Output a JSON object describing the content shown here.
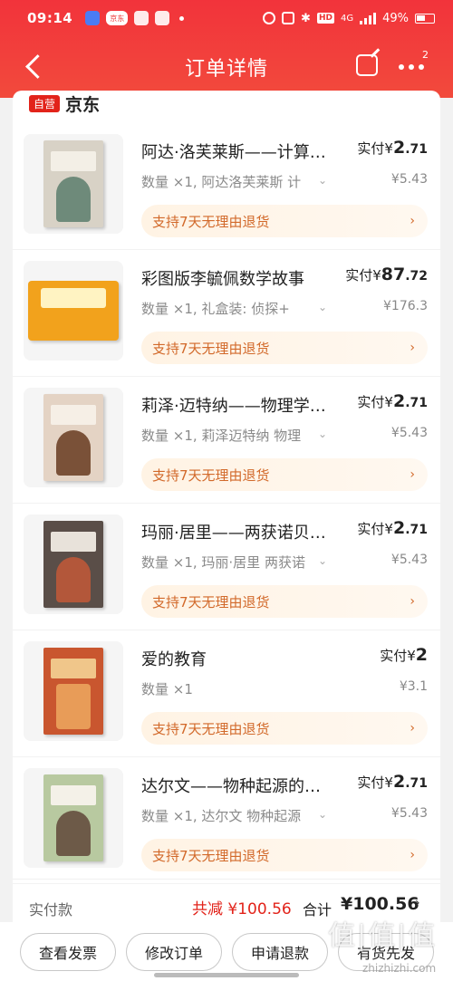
{
  "status": {
    "time": "09:14",
    "app_badge": "京东",
    "network": "4G",
    "hd": "HD",
    "battery": "49%"
  },
  "nav": {
    "title": "订单详情",
    "more_badge": "2"
  },
  "shop": {
    "badge": "自营",
    "name": "京东"
  },
  "items": [
    {
      "title": "阿达·洛芙莱斯——计算机之母",
      "spec": "数量 ×1, 阿达洛芙莱斯 计",
      "price_prefix": "实付¥",
      "price_int": "2",
      "price_dec": ".71",
      "orig_price": "¥5.43",
      "return_label": "支持7天无理由退货",
      "cover_color": "#d8d2c6",
      "cover_accent": "#6e8a7a"
    },
    {
      "title": "彩图版李毓佩数学故事",
      "spec": "数量 ×1, 礼盒装: 侦探+",
      "price_prefix": "实付¥",
      "price_int": "87",
      "price_dec": ".72",
      "orig_price": "¥176.3",
      "return_label": "支持7天无理由退货",
      "cover_color": "#f2a21c",
      "cover_accent": "#e3422c"
    },
    {
      "title": "莉泽·迈特纳——物理学之母",
      "spec": "数量 ×1, 莉泽迈特纳 物理",
      "price_prefix": "实付¥",
      "price_int": "2",
      "price_dec": ".71",
      "orig_price": "¥5.43",
      "return_label": "支持7天无理由退货",
      "cover_color": "#e4d3c4",
      "cover_accent": "#7a5138"
    },
    {
      "title": "玛丽·居里——两获诺贝尔奖",
      "spec": "数量 ×1, 玛丽·居里 两获诺",
      "price_prefix": "实付¥",
      "price_int": "2",
      "price_dec": ".71",
      "orig_price": "¥5.43",
      "return_label": "支持7天无理由退货",
      "cover_color": "#5a4e48",
      "cover_accent": "#b3573a"
    },
    {
      "title": "爱的教育",
      "spec": "数量 ×1",
      "price_prefix": "实付¥",
      "price_int": "2",
      "price_dec": "",
      "orig_price": "¥3.1",
      "return_label": "支持7天无理由退货",
      "cover_color": "#c9562f",
      "cover_accent": "#f0c68a"
    },
    {
      "title": "达尔文——物种起源的奥秘",
      "spec": "数量 ×1, 达尔文 物种起源",
      "price_prefix": "实付¥",
      "price_int": "2",
      "price_dec": ".71",
      "orig_price": "¥5.43",
      "return_label": "支持7天无理由退货",
      "cover_color": "#b8c9a0",
      "cover_accent": "#6d5a48"
    }
  ],
  "summary": {
    "paid_label": "实付款",
    "discount": "共减 ¥100.56",
    "total_label": "合计",
    "total_amount": "¥100.56"
  },
  "actions": {
    "invoice": "查看发票",
    "modify": "修改订单",
    "refund": "申请退款",
    "notify": "有货先发"
  },
  "watermark": {
    "logo": "值|值|值",
    "site": "zhizhizhi.com"
  }
}
